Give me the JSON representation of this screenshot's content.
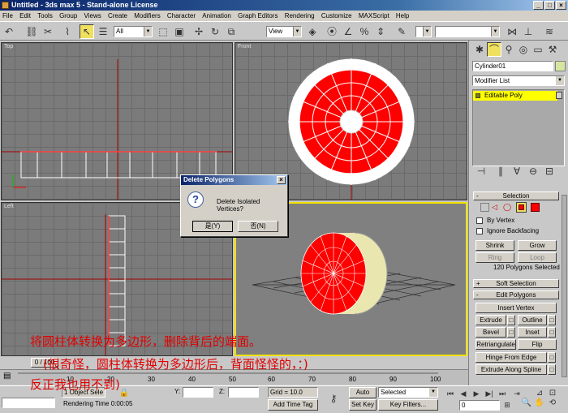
{
  "window": {
    "title": "Untitled - 3ds max 5 - Stand-alone License"
  },
  "menu": [
    "File",
    "Edit",
    "Tools",
    "Group",
    "Views",
    "Create",
    "Modifiers",
    "Character",
    "Animation",
    "Graph Editors",
    "Rendering",
    "Customize",
    "MAXScript",
    "Help"
  ],
  "toolbar": {
    "selection_filter": "All",
    "ref_coord": "View"
  },
  "viewports": {
    "top": "Top",
    "front": "Front",
    "left": "Left"
  },
  "command_panel": {
    "object_name": "Cylinder01",
    "modifier_list": "Modifier List",
    "stack_item": "Editable Poly",
    "selection": {
      "header": "Selection",
      "by_vertex": "By Vertex",
      "ignore_backfacing": "Ignore Backfacing",
      "shrink": "Shrink",
      "grow": "Grow",
      "ring": "Ring",
      "loop": "Loop",
      "status": "120 Polygons Selected"
    },
    "soft_selection": "Soft Selection",
    "edit_polygons": {
      "header": "Edit Polygons",
      "insert_vertex": "Insert Vertex",
      "extrude": "Extrude",
      "outline": "Outline",
      "bevel": "Bevel",
      "inset": "Inset",
      "retriangulate": "Retriangulate",
      "flip": "Flip",
      "hinge_from_edge": "Hinge From Edge",
      "extrude_along_spline": "Extrude Along Spline"
    }
  },
  "dialog": {
    "title": "Delete Polygons",
    "message": "Delete Isolated Vertices?",
    "yes": "是(Y)",
    "no": "否(N)",
    "close": "×"
  },
  "time": {
    "frame": "0 / 100",
    "ticks": [
      "10",
      "20",
      "30",
      "40",
      "50",
      "60",
      "70",
      "80",
      "90",
      "100"
    ]
  },
  "status": {
    "selection": "1 Object Sele",
    "rendering_time": "Rendering Time  0:00:05",
    "y_label": "Y:",
    "z_label": "Z:",
    "grid": "Grid = 10.0",
    "add_time_tag": "Add Time Tag",
    "auto_key": "Auto Key",
    "set_key": "Set Key",
    "selected": "Selected",
    "key_filters": "Key Filters...",
    "frame_value": "0"
  },
  "annotation": {
    "line1": "将圆柱体转换为多边形，删除背后的端面。",
    "line2": "(很奇怪，圆柱体转换为多边形后，背面怪怪的，：)",
    "line3": "反正我也用不到)"
  },
  "colors": {
    "active_viewport": "#f2e200",
    "selected_polys": "#ff0000",
    "annotation": "#e00000"
  }
}
